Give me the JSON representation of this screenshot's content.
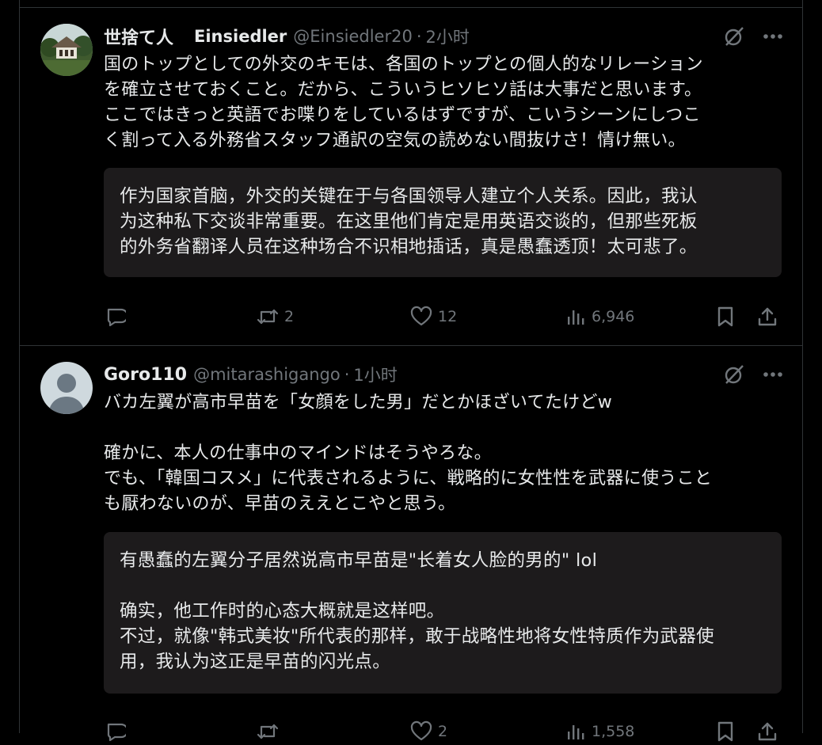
{
  "colors": {
    "background": "#000000",
    "text": "#e7e9ea",
    "muted": "#71767b",
    "border": "#2f3336",
    "translation_box": "#1d1b1c"
  },
  "posts": [
    {
      "display_name": "世捨て人",
      "display_name_2": "Einsiedler",
      "handle": "@Einsiedler20",
      "separator": "·",
      "time": "2小时",
      "text": "国のトップとしての外交のキモは、各国のトップとの個人的なリレーション\nを確立させておくこと。だから、こういうヒソヒソ話は大事だと思います。\nここではきっと英語でお喋りをしているはずですが、こいうシーンにしつこ\nく割って入る外務省スタッフ通訳の空気の読めない間抜けさ！情け無い。",
      "translation": "作为国家首脑，外交的关键在于与各国领导人建立个人关系。因此，我认\n为这种私下交谈非常重要。在这里他们肯定是用英语交谈的，但那些死板\n的外务省翻译人员在这种场合不识相地插话，真是愚蠢透顶！太可悲了。",
      "reply_count": "",
      "repost_count": "2",
      "like_count": "12",
      "view_count": "6,946",
      "icons": [
        "grok-icon",
        "more-icon",
        "reply-icon",
        "repost-icon",
        "like-icon",
        "views-icon",
        "bookmark-icon",
        "share-icon"
      ]
    },
    {
      "display_name": "Goro110",
      "handle": "@mitarashigango",
      "separator": "·",
      "time": "1小时",
      "text": "バカ左翼が高市早苗を「女顔をした男」だとかほざいてたけどw\n\n確かに、本人の仕事中のマインドはそうやろな。\nでも、「韓国コスメ」に代表されるように、戦略的に女性性を武器に使うこと\nも厭わないのが、早苗のええとこやと思う。",
      "translation": "有愚蠢的左翼分子居然说高市早苗是\"长着女人脸的男的\" lol\n\n确实，他工作时的心态大概就是这样吧。\n不过，就像\"韩式美妆\"所代表的那样，敢于战略性地将女性特质作为武器使\n用，我认为这正是早苗的闪光点。",
      "reply_count": "",
      "repost_count": "",
      "like_count": "2",
      "view_count": "1,558",
      "icons": [
        "grok-icon",
        "more-icon",
        "reply-icon",
        "repost-icon",
        "like-icon",
        "views-icon",
        "bookmark-icon",
        "share-icon"
      ]
    }
  ]
}
